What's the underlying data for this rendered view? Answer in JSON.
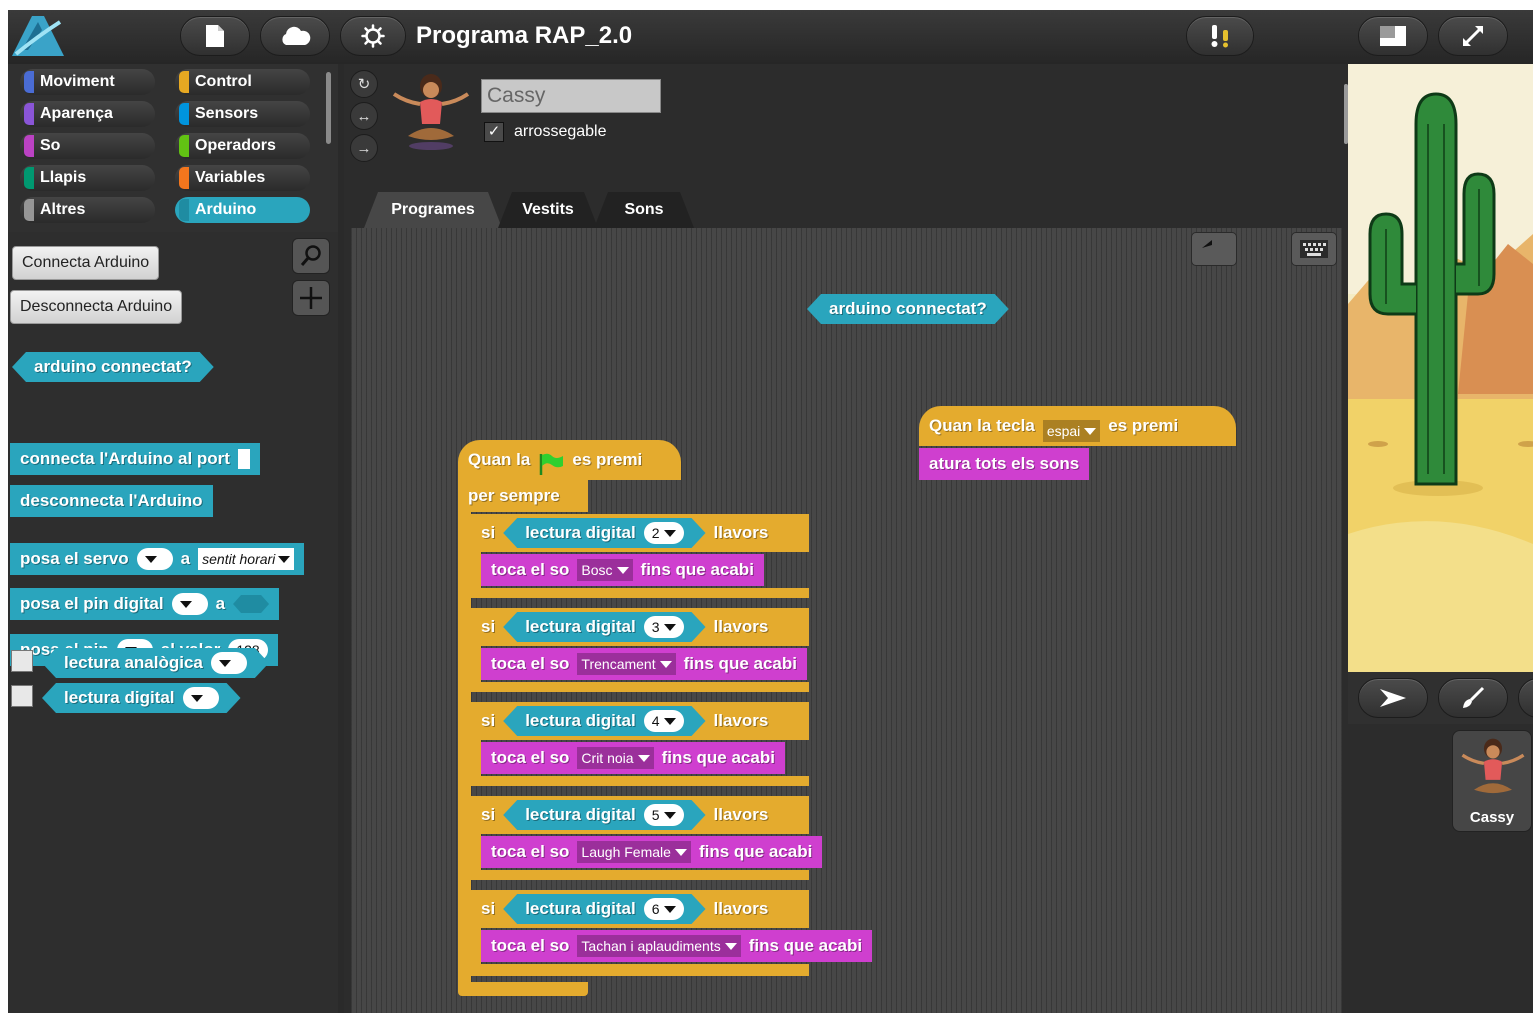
{
  "title": "Programa RAP_2.0",
  "categories": [
    {
      "label": "Moviment",
      "color": "#4a6cd4"
    },
    {
      "label": "Control",
      "color": "#e6a822"
    },
    {
      "label": "Aparença",
      "color": "#8a55d7"
    },
    {
      "label": "Sensors",
      "color": "#0094dd"
    },
    {
      "label": "So",
      "color": "#bb42c3"
    },
    {
      "label": "Operadors",
      "color": "#62c213"
    },
    {
      "label": "Llapis",
      "color": "#009870"
    },
    {
      "label": "Variables",
      "color": "#f3761d"
    },
    {
      "label": "Altres",
      "color": "#969696"
    },
    {
      "label": "Arduino",
      "color": "#2aa5bd"
    }
  ],
  "palette": {
    "connect_button": "Connecta Arduino",
    "disconnect_button": "Desconnecta Arduino",
    "blocks": {
      "connected": "arduino connectat?",
      "connect_port": "connecta l'Arduino al port",
      "disconnect": "desconnecta l'Arduino",
      "servo_a": "posa el servo",
      "servo_b": "a",
      "servo_value": "sentit horari",
      "digital_a": "posa el pin digital",
      "digital_b": "a",
      "pwm_a": "posa el pin",
      "pwm_b": "al valor",
      "pwm_value": "128",
      "analog_read": "lectura analògica",
      "digital_read": "lectura digital"
    }
  },
  "sprite": {
    "name": "Cassy",
    "draggable_label": "arrossegable",
    "draggable_checked": "✓"
  },
  "tabs": [
    "Programes",
    "Vestits",
    "Sons"
  ],
  "scripts": {
    "floating_reporter": "arduino connectat?",
    "flag_hat_a": "Quan la",
    "flag_hat_b": "es premi",
    "forever": "per sempre",
    "if_label": "si",
    "then_label": "llavors",
    "digital_read": "lectura digital",
    "play_a": "toca el so",
    "play_b": "fins que acabi",
    "conditions": [
      {
        "pin": "2",
        "sound": "Bosc"
      },
      {
        "pin": "3",
        "sound": "Trencament"
      },
      {
        "pin": "4",
        "sound": "Crit noia"
      },
      {
        "pin": "5",
        "sound": "Laugh Female"
      },
      {
        "pin": "6",
        "sound": "Tachan i aplaudiments"
      }
    ],
    "key_hat_a": "Quan la tecla",
    "key_value": "espai",
    "key_hat_b": "es premi",
    "stop_sounds": "atura tots els sons"
  }
}
